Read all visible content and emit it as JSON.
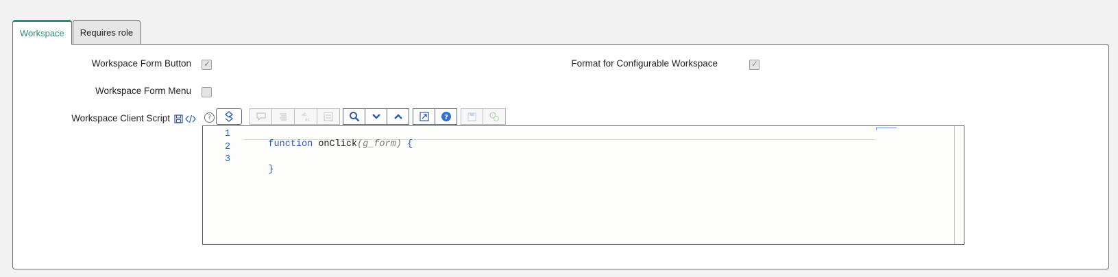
{
  "tabs": [
    {
      "label": "Workspace",
      "active": true
    },
    {
      "label": "Requires role",
      "active": false
    }
  ],
  "fields": {
    "workspace_form_button": {
      "label": "Workspace Form Button",
      "checked": true
    },
    "format_configurable_workspace": {
      "label": "Format for Configurable Workspace",
      "checked": true
    },
    "workspace_form_menu": {
      "label": "Workspace Form Menu",
      "checked": false
    },
    "workspace_client_script": {
      "label": "Workspace Client Script"
    }
  },
  "editor": {
    "lines": [
      {
        "num": "1",
        "tokens": [
          {
            "text": "function",
            "style": "kw"
          },
          {
            "text": " ",
            "style": "fn"
          },
          {
            "text": "onClick",
            "style": "fn"
          },
          {
            "text": "(",
            "style": "param"
          },
          {
            "text": "g_form",
            "style": "param"
          },
          {
            "text": ")",
            "style": "param"
          },
          {
            "text": " ",
            "style": "fn"
          },
          {
            "text": "{",
            "style": "br"
          }
        ]
      },
      {
        "num": "2",
        "tokens": []
      },
      {
        "num": "3",
        "tokens": [
          {
            "text": "}",
            "style": "br"
          }
        ]
      }
    ]
  },
  "toolbar": {
    "icons": [
      "toggle-syntax-icon",
      "comment-icon",
      "format-icon",
      "replace-icon",
      "replace-all-icon",
      "search-icon",
      "next-icon",
      "previous-icon",
      "fullscreen-icon",
      "help-icon",
      "save-icon",
      "script-debug-icon"
    ]
  },
  "colors": {
    "accent": "#2e8a7a",
    "keyword": "#2a59c7"
  }
}
